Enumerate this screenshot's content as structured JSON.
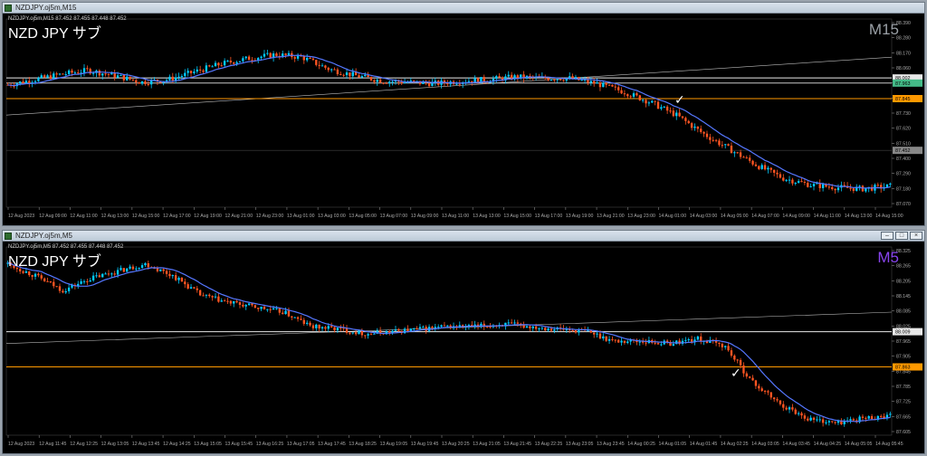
{
  "colors": {
    "bg": "#000000",
    "bull": "#00ccff",
    "bear": "#ff5522",
    "ma": "#5577ff",
    "hline_white": "#e8e8e8",
    "hline_orange": "#ff9900",
    "tag_green": "#44bb88",
    "tag_orange": "#ff9900"
  },
  "top": {
    "title": "NZDJPY.oj5m,M15",
    "info": "NZDJPY.oj5m,M15  87.452 87.455 87.448 87.452",
    "symbol": "NZD JPY サブ",
    "timeframe": "M15",
    "yticks": [
      "88.390",
      "88.280",
      "88.170",
      "88.060",
      "87.950",
      "87.840",
      "87.730",
      "87.620",
      "87.510",
      "87.400",
      "87.290",
      "87.180",
      "87.070"
    ],
    "tags": [
      "88.002",
      "87.963",
      "87.845",
      "87.452"
    ],
    "xticks": [
      "12 Aug 2023",
      "12 Aug 09:00",
      "12 Aug 11:00",
      "12 Aug 13:00",
      "12 Aug 15:00",
      "12 Aug 17:00",
      "12 Aug 19:00",
      "12 Aug 21:00",
      "12 Aug 23:00",
      "13 Aug 01:00",
      "13 Aug 03:00",
      "13 Aug 05:00",
      "13 Aug 07:00",
      "13 Aug 09:00",
      "13 Aug 11:00",
      "13 Aug 13:00",
      "13 Aug 15:00",
      "13 Aug 17:00",
      "13 Aug 19:00",
      "13 Aug 21:00",
      "13 Aug 23:00",
      "14 Aug 01:00",
      "14 Aug 03:00",
      "14 Aug 05:00",
      "14 Aug 07:00",
      "14 Aug 09:00",
      "14 Aug 11:00",
      "14 Aug 13:00",
      "14 Aug 15:00"
    ],
    "checkmark": "✓"
  },
  "bottom": {
    "title": "NZDJPY.oj5m,M5",
    "info": "NZDJPY.oj5m,M5  87.452 87.455 87.448 87.452",
    "symbol": "NZD JPY サブ",
    "timeframe": "M5",
    "yticks": [
      "88.325",
      "88.265",
      "88.205",
      "88.145",
      "88.085",
      "88.025",
      "87.965",
      "87.905",
      "87.845",
      "87.785",
      "87.725",
      "87.665",
      "87.605"
    ],
    "tags": [
      "88.009",
      "87.863"
    ],
    "xticks": [
      "12 Aug 2023",
      "12 Aug 11:45",
      "12 Aug 12:25",
      "12 Aug 13:05",
      "12 Aug 13:45",
      "12 Aug 14:25",
      "13 Aug 15:05",
      "13 Aug 15:45",
      "13 Aug 16:25",
      "13 Aug 17:05",
      "13 Aug 17:45",
      "13 Aug 18:25",
      "13 Aug 19:05",
      "13 Aug 19:45",
      "13 Aug 20:25",
      "13 Aug 21:05",
      "13 Aug 21:45",
      "13 Aug 22:25",
      "13 Aug 23:05",
      "13 Aug 23:45",
      "14 Aug 00:25",
      "14 Aug 01:05",
      "14 Aug 01:45",
      "14 Aug 02:25",
      "14 Aug 03:05",
      "14 Aug 03:45",
      "14 Aug 04:25",
      "14 Aug 05:05",
      "14 Aug 05:45"
    ],
    "checkmark": "✓"
  },
  "chart_data": [
    {
      "type": "candlestick",
      "title": "NZD JPY サブ M15",
      "price_range": [
        87.02,
        88.45
      ],
      "close_path": [
        87.95,
        87.99,
        88.03,
        88.06,
        88.02,
        87.97,
        87.99,
        88.05,
        88.11,
        88.15,
        88.18,
        88.16,
        88.07,
        88.02,
        87.98,
        87.97,
        87.96,
        87.98,
        87.99,
        88.01,
        88.0,
        88.0,
        87.96,
        87.9,
        87.82,
        87.72,
        87.58,
        87.46,
        87.34,
        87.24,
        87.19,
        87.17,
        87.16,
        87.18
      ],
      "hlines": [
        88.002,
        87.963,
        87.845,
        87.452
      ],
      "ma": "moving average (blue)"
    },
    {
      "type": "candlestick",
      "title": "NZD JPY サブ M5",
      "price_range": [
        87.58,
        88.36
      ],
      "close_path": [
        88.29,
        88.24,
        88.18,
        88.23,
        88.26,
        88.29,
        88.24,
        88.16,
        88.13,
        88.11,
        88.09,
        88.03,
        88.02,
        88.0,
        88.01,
        88.02,
        88.03,
        88.03,
        88.04,
        88.03,
        88.02,
        88.01,
        87.97,
        87.97,
        87.96,
        87.98,
        87.95,
        87.8,
        87.71,
        87.65,
        87.63,
        87.65,
        87.66
      ],
      "hlines": [
        88.009,
        87.863
      ],
      "ma": "moving average (blue)"
    }
  ]
}
